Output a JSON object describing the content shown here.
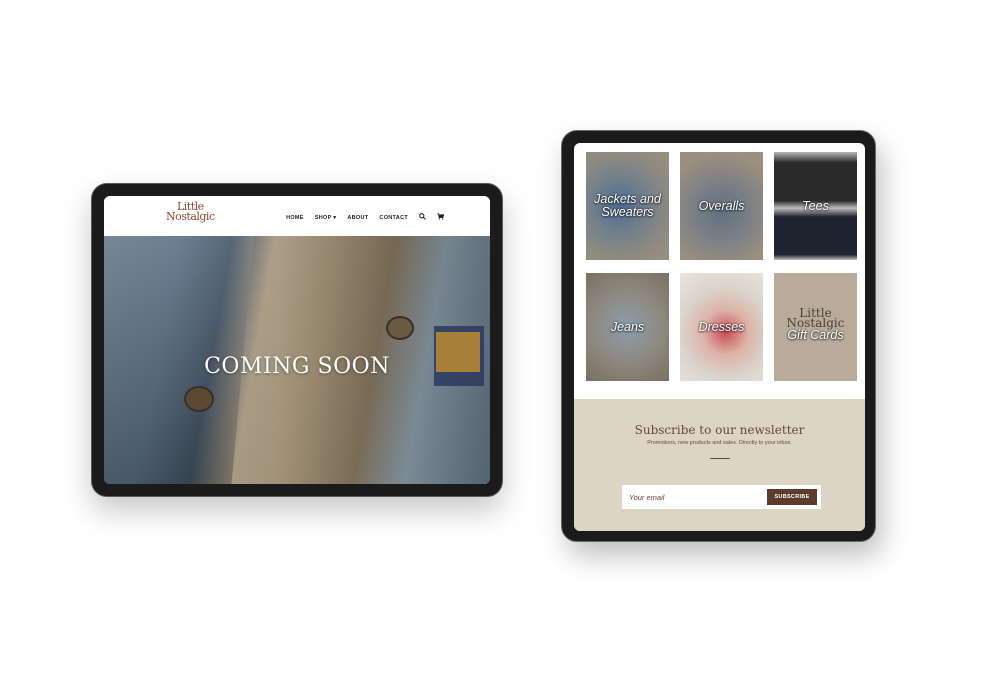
{
  "left_tablet": {
    "logo": {
      "line1": "Little",
      "line2": "Nostalgic"
    },
    "nav": [
      {
        "label": "HOME"
      },
      {
        "label": "SHOP"
      },
      {
        "label": "ABOUT"
      },
      {
        "label": "CONTACT"
      }
    ],
    "shop_caret": "▾",
    "search_icon": "search-icon",
    "cart_icon": "cart-icon",
    "hero_title": "COMING SOON"
  },
  "right_tablet": {
    "categories": [
      {
        "label": "Jackets and Sweaters"
      },
      {
        "label": "Overalls"
      },
      {
        "label": "Tees"
      },
      {
        "label": "Jeans"
      },
      {
        "label": "Dresses"
      },
      {
        "label": "Gift Cards"
      }
    ],
    "gift_card": {
      "logo_line1": "Little",
      "logo_line2": "Nostalgic"
    },
    "newsletter": {
      "title": "Subscribe to our newsletter",
      "subtitle": "Promotions, new products and sales. Directly to your inbox.",
      "email_placeholder": "Your email",
      "button_label": "SUBSCRIBE"
    }
  },
  "colors": {
    "brand_brown": "#5d3b2c",
    "newsletter_bg": "#ddd5c3",
    "logo": "#8a4a32"
  }
}
